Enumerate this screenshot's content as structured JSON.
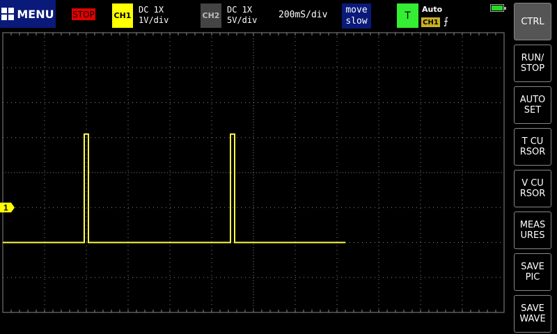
{
  "topbar": {
    "menu_label": "MENU",
    "run_state": "STOP",
    "ch1": {
      "badge": "CH1",
      "coupling": "DC  1X",
      "scale": "1V/div"
    },
    "ch2": {
      "badge": "CH2",
      "coupling": "DC  1X",
      "scale": "5V/div"
    },
    "timebase": "200mS/div",
    "move": {
      "line1": "move",
      "line2": "slow"
    },
    "trigger": {
      "badge": "T",
      "mode": "Auto",
      "source": "CH1",
      "edge": "⨍"
    },
    "battery_level": 1.0
  },
  "scope": {
    "channel_marker": "1",
    "colors": {
      "trace": "#ffff44",
      "grid": "#888888",
      "marker": "#ffff00"
    },
    "trace": {
      "baseline_div": -2.0,
      "pulse_high_div": 1.1,
      "pulses_at_div": [
        [
          1.95,
          2.05
        ],
        [
          5.45,
          5.55
        ]
      ],
      "end_div": 8.2
    }
  },
  "side_buttons": [
    {
      "label": "CTRL",
      "active": true
    },
    {
      "label": "RUN/\nSTOP",
      "active": false
    },
    {
      "label": "AUTO\nSET",
      "active": false
    },
    {
      "label": "T  CU\nRSOR",
      "active": false
    },
    {
      "label": "V  CU\nRSOR",
      "active": false
    },
    {
      "label": "MEAS\nURES",
      "active": false
    },
    {
      "label": "SAVE\nPIC",
      "active": false
    },
    {
      "label": "SAVE\nWAVE",
      "active": false
    }
  ]
}
